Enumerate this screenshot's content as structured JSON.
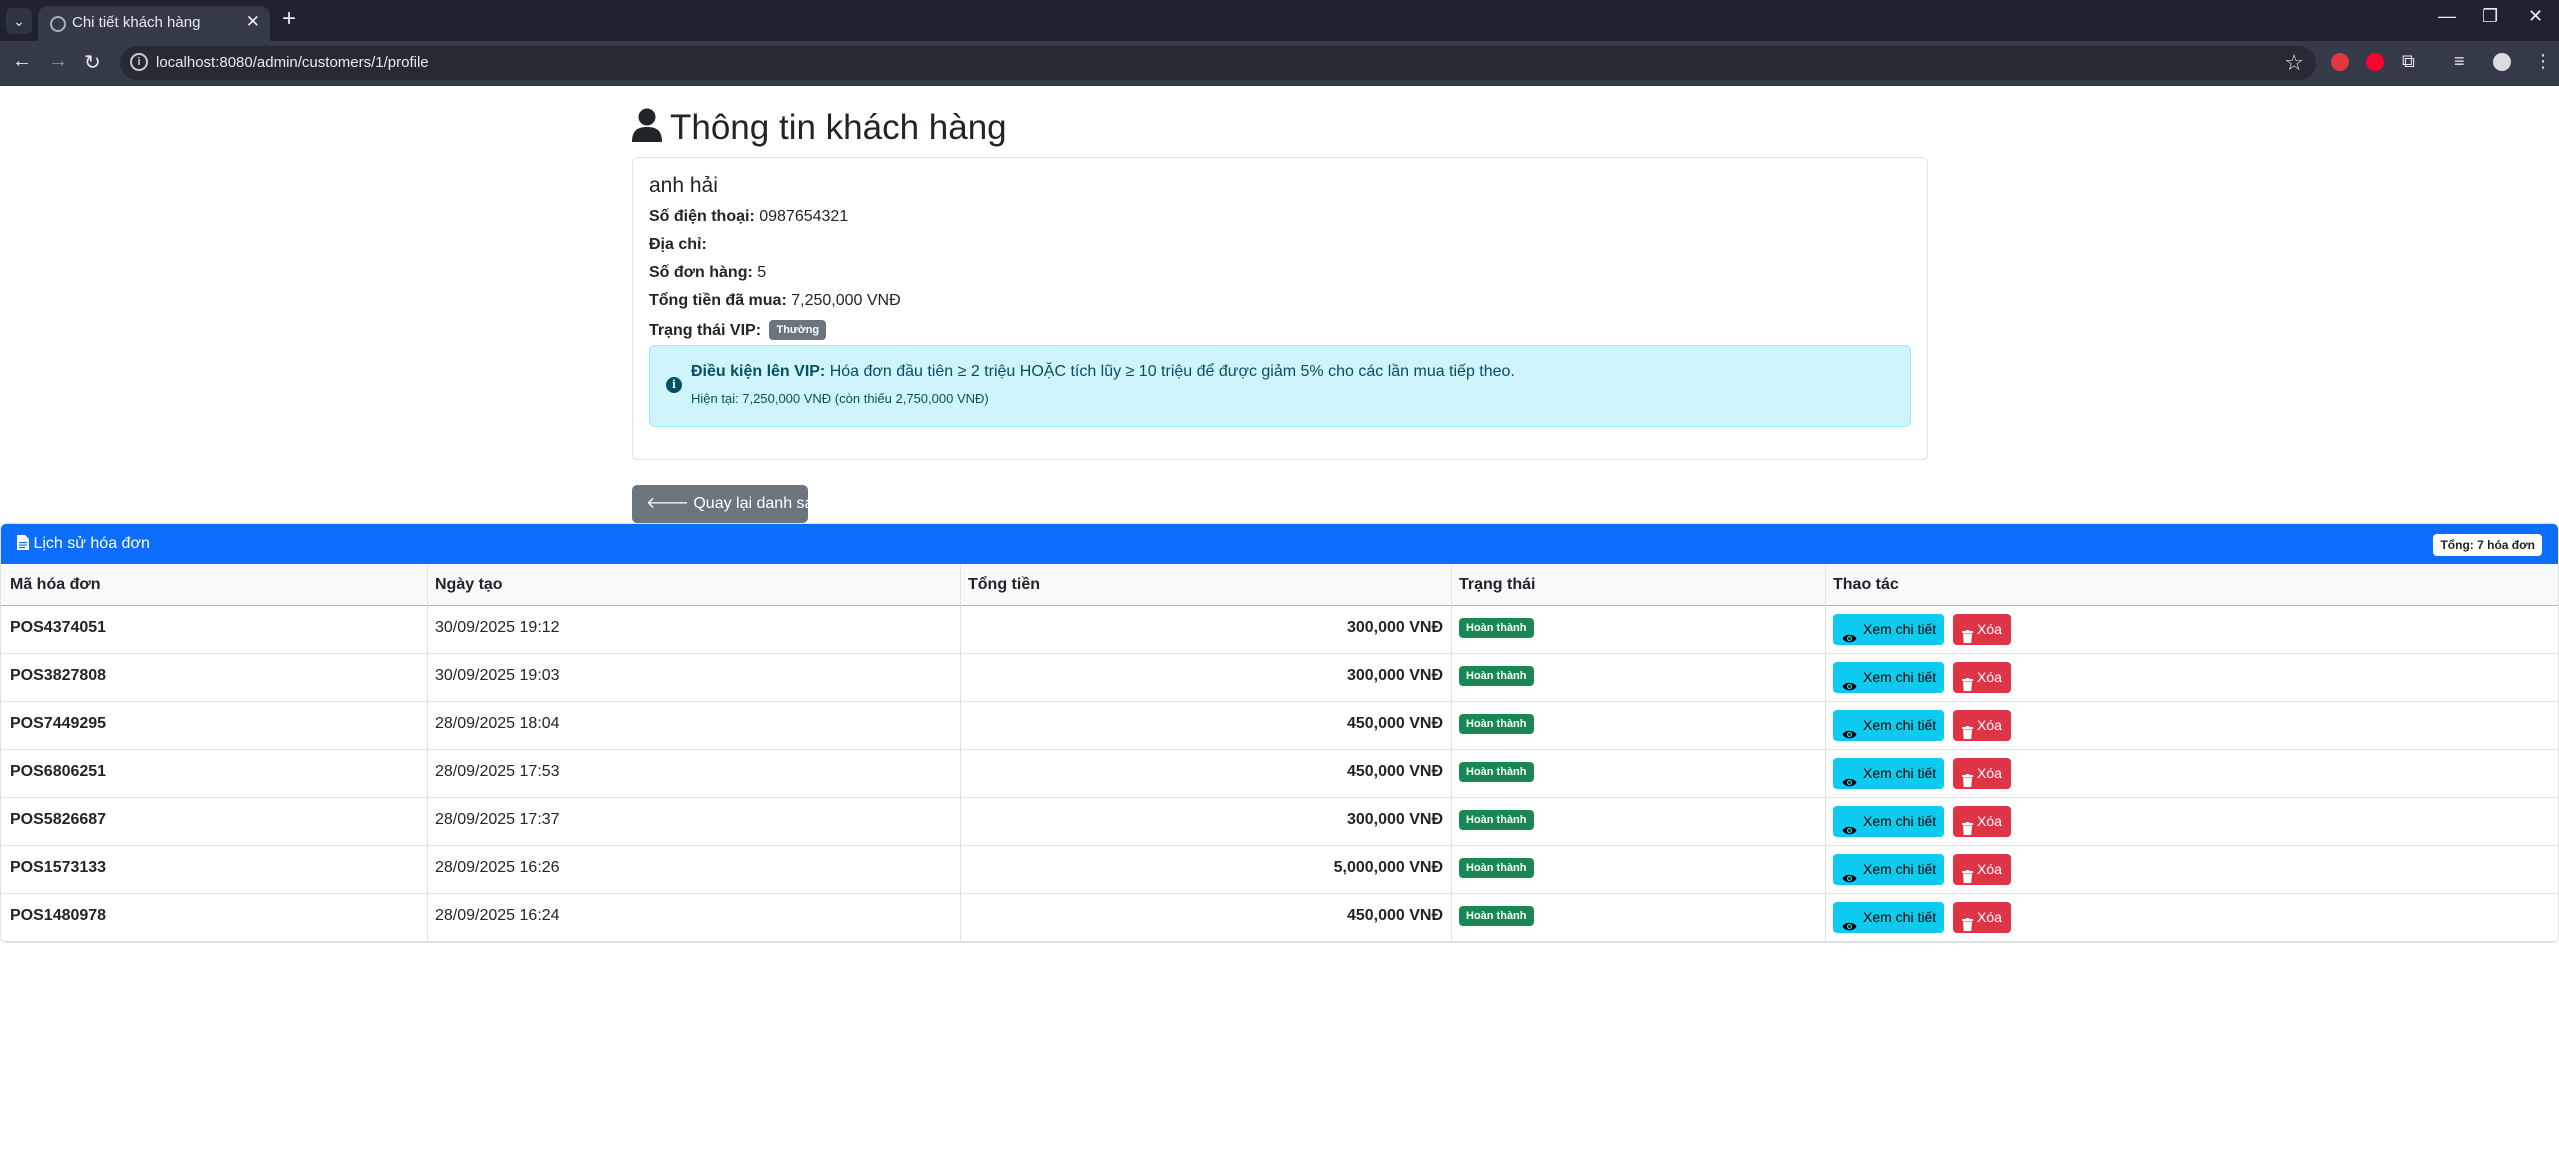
{
  "browser": {
    "tab_title": "Chi tiết khách hàng",
    "url": "localhost:8080/admin/customers/1/profile"
  },
  "page": {
    "title": "Thông tin khách hàng",
    "customer": {
      "name": "anh hải",
      "phone_label": "Số điện thoại:",
      "phone": "0987654321",
      "address_label": "Địa chỉ:",
      "address": "",
      "orders_label": "Số đơn hàng:",
      "orders": "5",
      "total_label": "Tổng tiền đã mua:",
      "total": "7,250,000 VNĐ",
      "vip_label": "Trạng thái VIP:",
      "vip_status": "Thường"
    },
    "vip_alert": {
      "label": "Điều kiện lên VIP:",
      "text": "Hóa đơn đầu tiên ≥ 2 triệu HOẶC tích lũy ≥ 10 triệu để được giảm 5% cho các lần mua tiếp theo.",
      "current": "Hiện tại: 7,250,000 VNĐ (còn thiếu 2,750,000 VNĐ)"
    },
    "back_button": "Quay lại danh sách"
  },
  "history": {
    "title": "Lịch sử hóa đơn",
    "count_badge": "Tổng: 7 hóa đơn",
    "columns": [
      "Mã hóa đơn",
      "Ngày tạo",
      "Tổng tiền",
      "Trạng thái",
      "Thao tác"
    ],
    "view_label": "Xem chi tiết",
    "delete_label": "Xóa",
    "rows": [
      {
        "code": "POS4374051",
        "date": "30/09/2025 19:12",
        "total": "300,000 VNĐ",
        "status": "Hoàn thành"
      },
      {
        "code": "POS3827808",
        "date": "30/09/2025 19:03",
        "total": "300,000 VNĐ",
        "status": "Hoàn thành"
      },
      {
        "code": "POS7449295",
        "date": "28/09/2025 18:04",
        "total": "450,000 VNĐ",
        "status": "Hoàn thành"
      },
      {
        "code": "POS6806251",
        "date": "28/09/2025 17:53",
        "total": "450,000 VNĐ",
        "status": "Hoàn thành"
      },
      {
        "code": "POS5826687",
        "date": "28/09/2025 17:37",
        "total": "300,000 VNĐ",
        "status": "Hoàn thành"
      },
      {
        "code": "POS1573133",
        "date": "28/09/2025 16:26",
        "total": "5,000,000 VNĐ",
        "status": "Hoàn thành"
      },
      {
        "code": "POS1480978",
        "date": "28/09/2025 16:24",
        "total": "450,000 VNĐ",
        "status": "Hoàn thành"
      }
    ]
  },
  "colors": {
    "primary": "#0d6efd",
    "secondary": "#6c757d",
    "success": "#198754",
    "info": "#0dcaf0",
    "danger": "#dc3545",
    "alert_bg": "#cff4fc"
  }
}
